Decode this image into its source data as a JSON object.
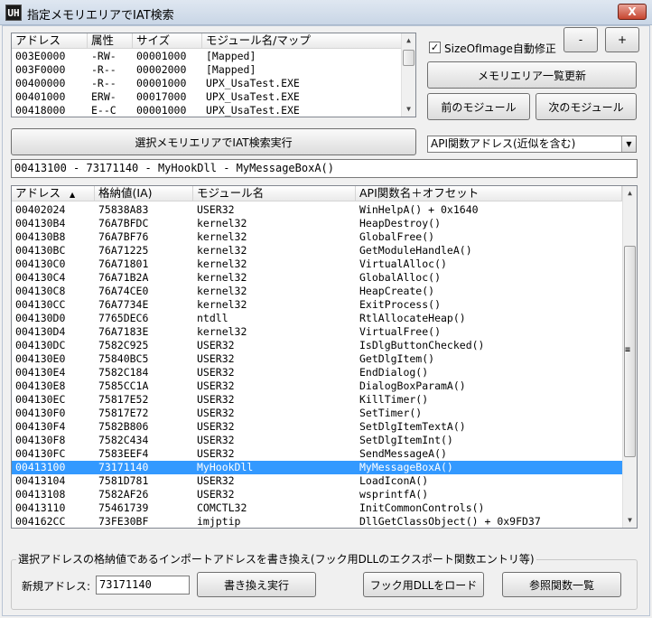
{
  "window": {
    "title": "指定メモリエリアでIAT検索",
    "icon_text": "UH",
    "close_label": "X"
  },
  "memory_list": {
    "columns": [
      "アドレス",
      "属性",
      "サイズ",
      "モジュール名/マップ"
    ],
    "rows": [
      [
        "003E0000",
        "-RW-",
        "00001000",
        "[Mapped]"
      ],
      [
        "003F0000",
        "-R--",
        "00002000",
        "[Mapped]"
      ],
      [
        "00400000",
        "-R--",
        "00001000",
        "UPX_UsaTest.EXE"
      ],
      [
        "00401000",
        "ERW-",
        "00017000",
        "UPX_UsaTest.EXE"
      ],
      [
        "00418000",
        "E--C",
        "00001000",
        "UPX_UsaTest.EXE"
      ]
    ]
  },
  "controls": {
    "sizeofimage_label": "SizeOfImage自動修正",
    "sizeofimage_checked": "✓",
    "minus_label": "-",
    "plus_label": "+",
    "refresh_label": "メモリエリア一覧更新",
    "prev_module_label": "前のモジュール",
    "next_module_label": "次のモジュール",
    "search_label": "選択メモリエリアでIAT検索実行",
    "api_mode_value": "API関数アドレス(近似を含む)"
  },
  "selection_text": "00413100 - 73171140 - MyHookDll - MyMessageBoxA()",
  "iat_list": {
    "columns": [
      "アドレス",
      "格納値(IA)",
      "モジュール名",
      "API関数名＋オフセット"
    ],
    "sort_indicator": "▲",
    "rows": [
      [
        "00402024",
        "75838A83",
        "USER32",
        "WinHelpA() + 0x1640"
      ],
      [
        "004130B4",
        "76A7BFDC",
        "kernel32",
        "HeapDestroy()"
      ],
      [
        "004130B8",
        "76A7BF76",
        "kernel32",
        "GlobalFree()"
      ],
      [
        "004130BC",
        "76A71225",
        "kernel32",
        "GetModuleHandleA()"
      ],
      [
        "004130C0",
        "76A71801",
        "kernel32",
        "VirtualAlloc()"
      ],
      [
        "004130C4",
        "76A71B2A",
        "kernel32",
        "GlobalAlloc()"
      ],
      [
        "004130C8",
        "76A74CE0",
        "kernel32",
        "HeapCreate()"
      ],
      [
        "004130CC",
        "76A7734E",
        "kernel32",
        "ExitProcess()"
      ],
      [
        "004130D0",
        "7765DEC6",
        "ntdll",
        "RtlAllocateHeap()"
      ],
      [
        "004130D4",
        "76A7183E",
        "kernel32",
        "VirtualFree()"
      ],
      [
        "004130DC",
        "7582C925",
        "USER32",
        "IsDlgButtonChecked()"
      ],
      [
        "004130E0",
        "75840BC5",
        "USER32",
        "GetDlgItem()"
      ],
      [
        "004130E4",
        "7582C184",
        "USER32",
        "EndDialog()"
      ],
      [
        "004130E8",
        "7585CC1A",
        "USER32",
        "DialogBoxParamA()"
      ],
      [
        "004130EC",
        "75817E52",
        "USER32",
        "KillTimer()"
      ],
      [
        "004130F0",
        "75817E72",
        "USER32",
        "SetTimer()"
      ],
      [
        "004130F4",
        "7582B806",
        "USER32",
        "SetDlgItemTextA()"
      ],
      [
        "004130F8",
        "7582C434",
        "USER32",
        "SetDlgItemInt()"
      ],
      [
        "004130FC",
        "7583EEF4",
        "USER32",
        "SendMessageA()"
      ],
      [
        "00413100",
        "73171140",
        "MyHookDll",
        "MyMessageBoxA()"
      ],
      [
        "00413104",
        "7581D781",
        "USER32",
        "LoadIconA()"
      ],
      [
        "00413108",
        "7582AF26",
        "USER32",
        "wsprintfA()"
      ],
      [
        "00413110",
        "75461739",
        "COMCTL32",
        "InitCommonControls()"
      ],
      [
        "004162CC",
        "73FE30BF",
        "imjptip",
        "DllGetClassObject() + 0x9FD37"
      ]
    ],
    "selected_index": 19
  },
  "rewrite_group": {
    "caption": "選択アドレスの格納値であるインポートアドレスを書き換え(フック用DLLのエクスポート関数エントリ等)",
    "new_address_label": "新規アドレス:",
    "new_address_value": "73171140",
    "execute_label": "書き換え実行",
    "load_dll_label": "フック用DLLをロード",
    "ref_funcs_label": "参照関数一覧"
  },
  "icons": {
    "scroll_up": "▲",
    "scroll_down": "▼",
    "dropdown": "▼",
    "grip": "≡"
  }
}
